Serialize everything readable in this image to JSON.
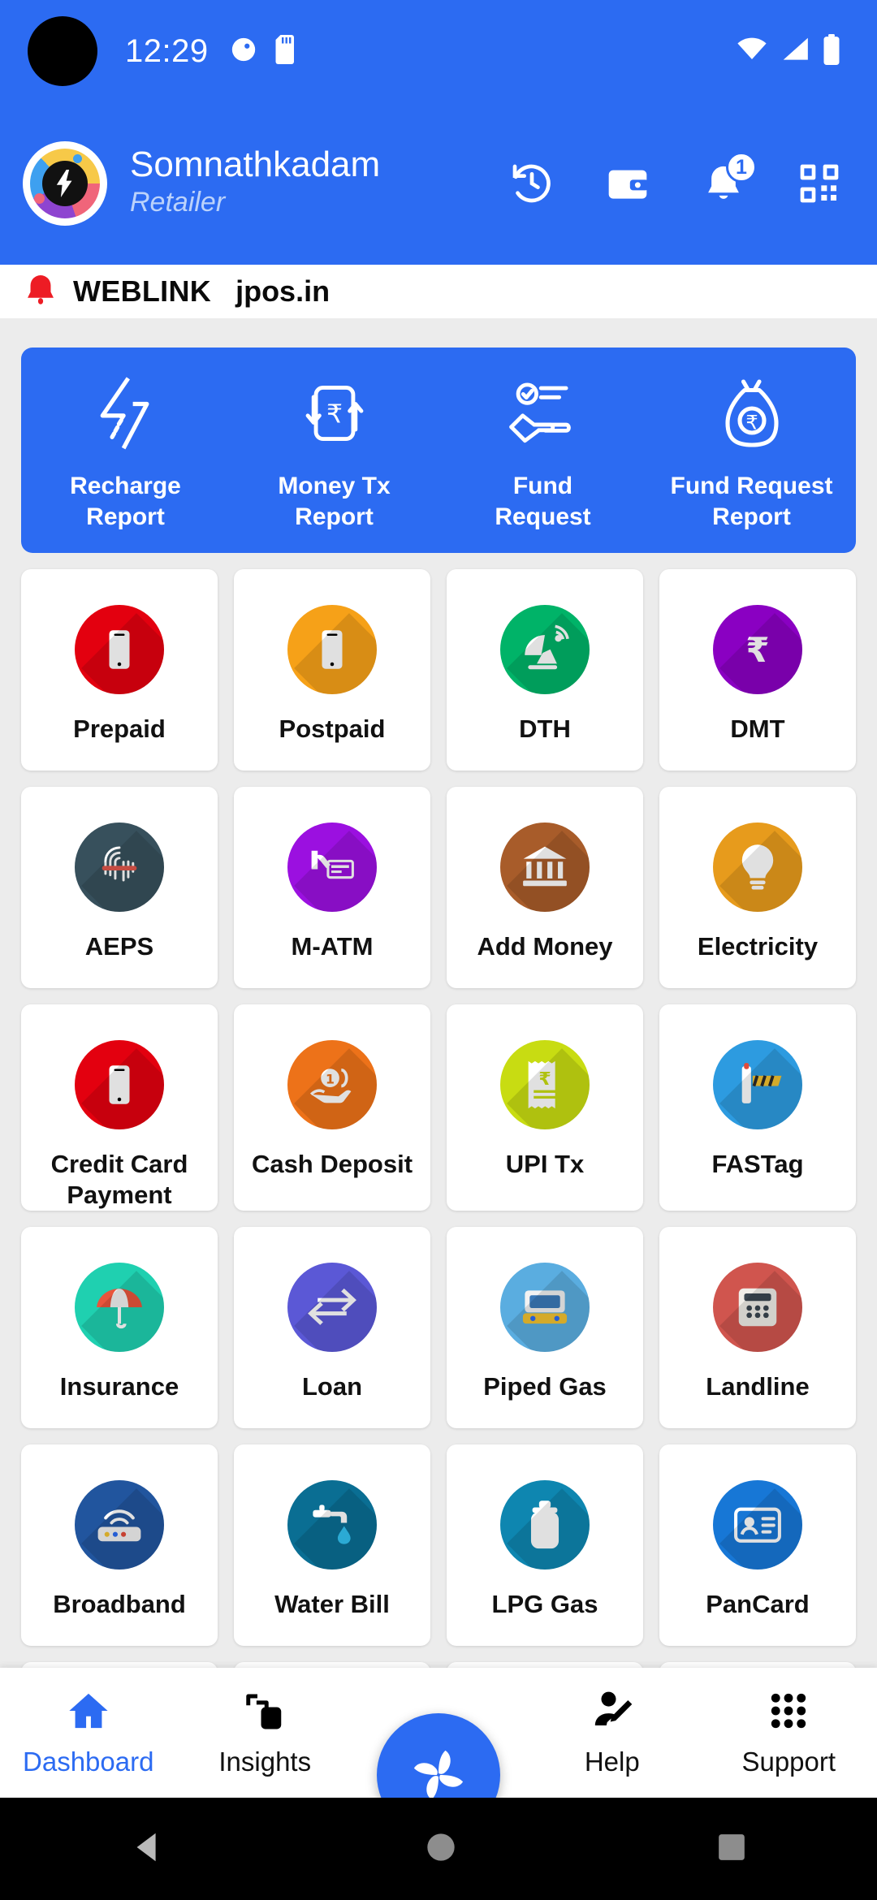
{
  "statusbar": {
    "time": "12:29",
    "icons": [
      "do-not-disturb-icon",
      "sd-card-icon"
    ],
    "right_icons": [
      "wifi-icon",
      "signal-icon",
      "battery-icon"
    ]
  },
  "header": {
    "user_name": "Somnathkadam",
    "role": "Retailer",
    "actions": [
      {
        "name": "history-icon",
        "label": "History"
      },
      {
        "name": "wallet-icon",
        "label": "Wallet"
      },
      {
        "name": "notification-bell-icon",
        "label": "Notifications",
        "badge": "1"
      },
      {
        "name": "qr-scan-icon",
        "label": "Scan QR"
      }
    ]
  },
  "weblink": {
    "icon": "bell-icon",
    "title": "WEBLINK",
    "url": "jpos.in"
  },
  "quick_panel": [
    {
      "label": "Recharge\nReport",
      "icon": "lightning-bolt-icon"
    },
    {
      "label": "Money Tx\nReport",
      "icon": "money-transfer-icon"
    },
    {
      "label": "Fund\nRequest",
      "icon": "hand-check-icon"
    },
    {
      "label": "Fund Request\nReport",
      "icon": "money-bag-icon"
    }
  ],
  "services": [
    {
      "label": "Prepaid",
      "icon": "mobile-icon",
      "color": "#E3000F"
    },
    {
      "label": "Postpaid",
      "icon": "mobile-icon",
      "color": "#F6A118"
    },
    {
      "label": "DTH",
      "icon": "satellite-dish-icon",
      "color": "#00B368"
    },
    {
      "label": "DMT",
      "icon": "rupee-icon",
      "color": "#8A00C2"
    },
    {
      "label": "AEPS",
      "icon": "fingerprint-scan-icon",
      "color": "#37505C"
    },
    {
      "label": "M-ATM",
      "icon": "card-swipe-icon",
      "color": "#9B10E0"
    },
    {
      "label": "Add Money",
      "icon": "bank-icon",
      "color": "#A85C2A"
    },
    {
      "label": "Electricity",
      "icon": "light-bulb-icon",
      "color": "#E79B1C"
    },
    {
      "label": "Credit Card\nPayment",
      "icon": "mobile-icon",
      "color": "#E3000F"
    },
    {
      "label": "Cash Deposit",
      "icon": "cash-hand-icon",
      "color": "#ED7219"
    },
    {
      "label": "UPI Tx",
      "icon": "receipt-icon",
      "color": "#C8DC12"
    },
    {
      "label": "FASTag",
      "icon": "toll-barrier-icon",
      "color": "#2D9BE0"
    },
    {
      "label": "Insurance",
      "icon": "umbrella-icon",
      "color": "#1FD0B0"
    },
    {
      "label": "Loan",
      "icon": "exchange-arrows-icon",
      "color": "#5B58D6"
    },
    {
      "label": "Piped Gas",
      "icon": "gas-stove-icon",
      "color": "#5AADE0"
    },
    {
      "label": "Landline",
      "icon": "telephone-icon",
      "color": "#D0554E"
    },
    {
      "label": "Broadband",
      "icon": "router-icon",
      "color": "#21559E"
    },
    {
      "label": "Water Bill",
      "icon": "tap-water-icon",
      "color": "#0A6E93"
    },
    {
      "label": "LPG Gas",
      "icon": "gas-cylinder-icon",
      "color": "#0E86B0"
    },
    {
      "label": "PanCard",
      "icon": "id-card-icon",
      "color": "#1777D6"
    },
    {
      "label": "",
      "icon": "partial-icon",
      "color": "#6246E8"
    },
    {
      "label": "",
      "icon": "partial-icon",
      "color": "#8E13CE"
    },
    {
      "label": "",
      "icon": "partial-icon",
      "color": "#F3C642"
    },
    {
      "label": "",
      "icon": "partial-icon",
      "color": "#8BC53F"
    }
  ],
  "bottom_nav": {
    "items": [
      {
        "label": "Dashboard",
        "icon": "home-icon",
        "active": true
      },
      {
        "label": "Insights",
        "icon": "layers-icon",
        "active": false
      },
      {
        "label": "Help",
        "icon": "user-edit-icon",
        "active": false
      },
      {
        "label": "Support",
        "icon": "grid-apps-icon",
        "active": false
      }
    ],
    "fab_icon": "pinwheel-icon"
  },
  "android_nav": [
    "back-triangle-icon",
    "home-circle-icon",
    "recents-square-icon"
  ],
  "colors": {
    "brand_blue": "#2C6BF2",
    "page_bg": "#ECECEC",
    "card_bg": "#FFFFFF"
  }
}
